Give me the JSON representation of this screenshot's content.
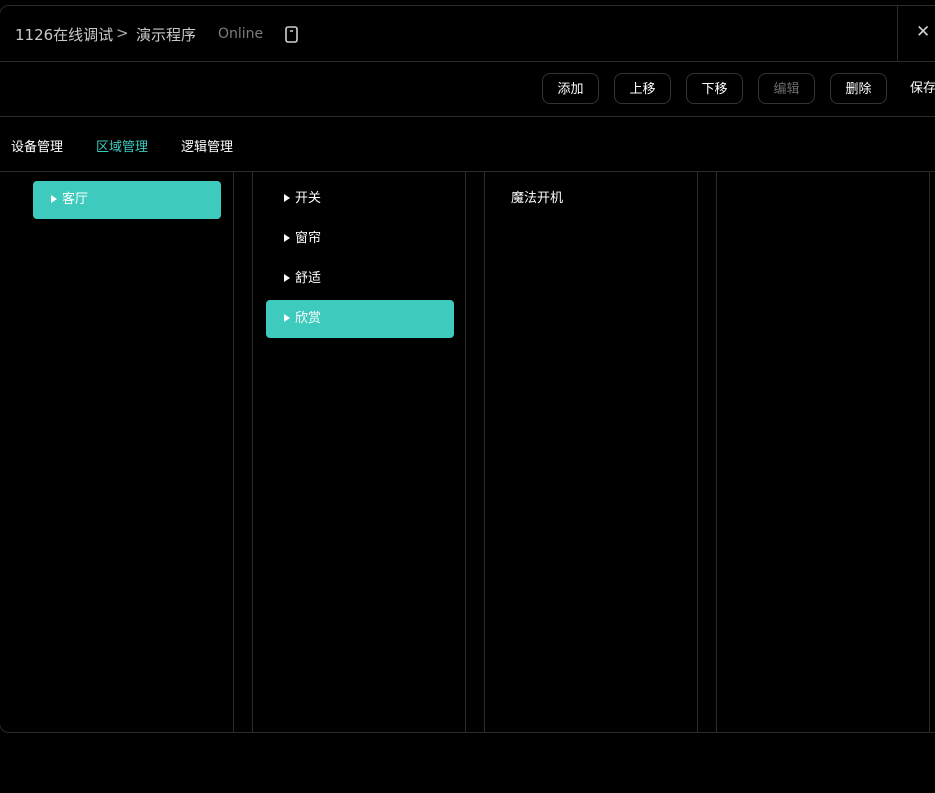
{
  "header": {
    "project": "1126在线调试",
    "separator": ">",
    "program": "演示程序",
    "status": "Online",
    "close_glyph": "✕"
  },
  "toolbar": {
    "add": "添加",
    "move_up": "上移",
    "move_down": "下移",
    "edit": "编辑",
    "delete": "删除",
    "save": "保存"
  },
  "tabs": {
    "device": "设备管理",
    "area": "区域管理",
    "logic": "逻辑管理"
  },
  "rooms": [
    "客厅"
  ],
  "groups": [
    "开关",
    "窗帘",
    "舒适",
    "欣赏"
  ],
  "scenes": [
    "魔法开机"
  ],
  "colors": {
    "accent": "#3ecbbd",
    "background": "#000000",
    "border": "#2a2a2a"
  }
}
